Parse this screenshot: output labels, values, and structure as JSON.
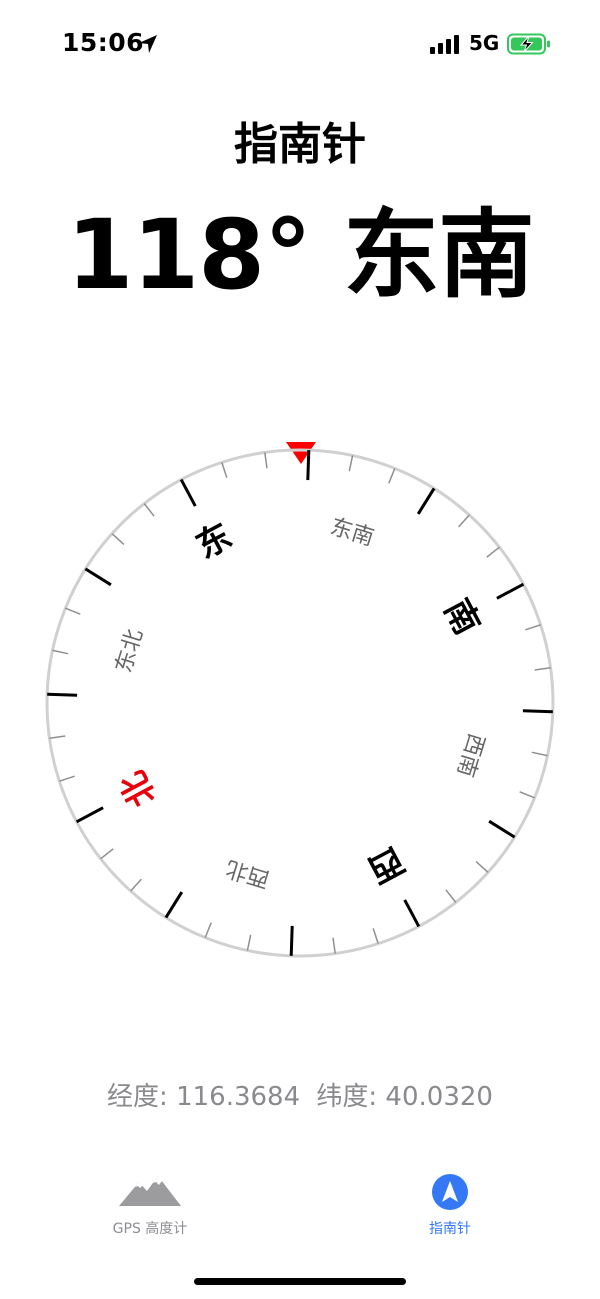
{
  "status_bar": {
    "time": "15:06",
    "network": "5G",
    "icons": [
      "location-arrow-icon",
      "signal-bars-icon",
      "battery-charging-icon"
    ],
    "battery_color": "#34c759"
  },
  "screen": {
    "title": "指南针",
    "heading_readout": "118° 东南"
  },
  "compass": {
    "heading_degrees": 118,
    "pointer_color": "#ff0000",
    "cardinal_labels": {
      "north": "北",
      "east": "东",
      "south": "南",
      "west": "西"
    },
    "intercardinal_labels": {
      "northeast": "东北",
      "southeast": "东南",
      "southwest": "西南",
      "northwest": "西北"
    },
    "north_color": "#e8000b"
  },
  "location": {
    "longitude_label": "经度: 116.3684",
    "latitude_label": "纬度: 40.0320"
  },
  "tab_bar": {
    "tabs": [
      {
        "label": "GPS 高度计",
        "icon": "mountain-icon",
        "selected": false
      },
      {
        "label": "指南针",
        "icon": "compass-arrow-icon",
        "selected": true
      }
    ],
    "accent": "#3478f6"
  }
}
